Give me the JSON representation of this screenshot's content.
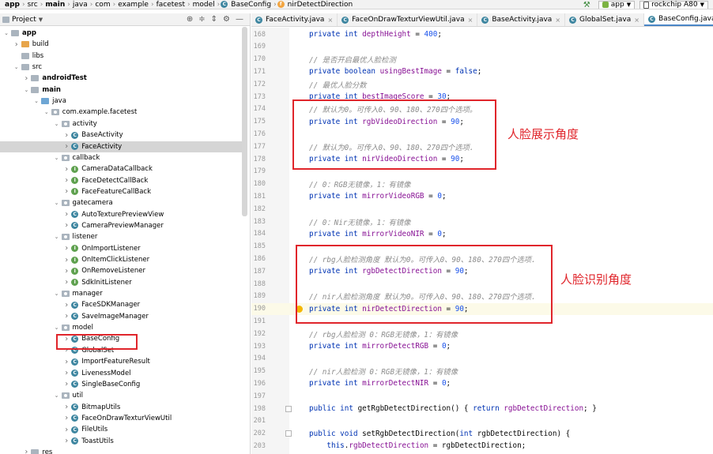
{
  "breadcrumb": {
    "items": [
      "app",
      "src",
      "main",
      "java",
      "com",
      "example",
      "facetest",
      "model",
      "BaseConfig",
      "nirDetectDirection"
    ],
    "bold_items": [
      0,
      2
    ]
  },
  "toolbar": {
    "run_config": "app",
    "device": "rockchip A80"
  },
  "project_panel": {
    "title": "Project",
    "tree": [
      {
        "label": "app",
        "depth": 0,
        "arrow": "v",
        "icon": "folder-gray",
        "bold": true
      },
      {
        "label": "build",
        "depth": 1,
        "arrow": ">",
        "icon": "folder-orange"
      },
      {
        "label": "libs",
        "depth": 1,
        "arrow": "",
        "icon": "folder-gray"
      },
      {
        "label": "src",
        "depth": 1,
        "arrow": "v",
        "icon": "folder-gray"
      },
      {
        "label": "androidTest",
        "depth": 2,
        "arrow": ">",
        "icon": "folder-gray",
        "bold": true
      },
      {
        "label": "main",
        "depth": 2,
        "arrow": "v",
        "icon": "folder-gray",
        "bold": true
      },
      {
        "label": "java",
        "depth": 3,
        "arrow": "v",
        "icon": "folder-blue"
      },
      {
        "label": "com.example.facetest",
        "depth": 4,
        "arrow": "v",
        "icon": "package"
      },
      {
        "label": "activity",
        "depth": 5,
        "arrow": "v",
        "icon": "package"
      },
      {
        "label": "BaseActivity",
        "depth": 6,
        "arrow": ">",
        "icon": "class"
      },
      {
        "label": "FaceActivity",
        "depth": 6,
        "arrow": ">",
        "icon": "class",
        "selected": true
      },
      {
        "label": "callback",
        "depth": 5,
        "arrow": "v",
        "icon": "package"
      },
      {
        "label": "CameraDataCallback",
        "depth": 6,
        "arrow": ">",
        "icon": "interface"
      },
      {
        "label": "FaceDetectCallBack",
        "depth": 6,
        "arrow": ">",
        "icon": "interface"
      },
      {
        "label": "FaceFeatureCallBack",
        "depth": 6,
        "arrow": ">",
        "icon": "interface"
      },
      {
        "label": "gatecamera",
        "depth": 5,
        "arrow": "v",
        "icon": "package"
      },
      {
        "label": "AutoTexturePreviewView",
        "depth": 6,
        "arrow": ">",
        "icon": "class"
      },
      {
        "label": "CameraPreviewManager",
        "depth": 6,
        "arrow": ">",
        "icon": "class"
      },
      {
        "label": "listener",
        "depth": 5,
        "arrow": "v",
        "icon": "package"
      },
      {
        "label": "OnImportListener",
        "depth": 6,
        "arrow": ">",
        "icon": "interface"
      },
      {
        "label": "OnItemClickListener",
        "depth": 6,
        "arrow": ">",
        "icon": "interface"
      },
      {
        "label": "OnRemoveListener",
        "depth": 6,
        "arrow": ">",
        "icon": "interface"
      },
      {
        "label": "SdkInitListener",
        "depth": 6,
        "arrow": ">",
        "icon": "interface"
      },
      {
        "label": "manager",
        "depth": 5,
        "arrow": "v",
        "icon": "package"
      },
      {
        "label": "FaceSDKManager",
        "depth": 6,
        "arrow": ">",
        "icon": "class"
      },
      {
        "label": "SaveImageManager",
        "depth": 6,
        "arrow": ">",
        "icon": "class"
      },
      {
        "label": "model",
        "depth": 5,
        "arrow": "v",
        "icon": "package"
      },
      {
        "label": "BaseConfig",
        "depth": 6,
        "arrow": ">",
        "icon": "class"
      },
      {
        "label": "GlobalSet",
        "depth": 6,
        "arrow": ">",
        "icon": "class"
      },
      {
        "label": "ImportFeatureResult",
        "depth": 6,
        "arrow": ">",
        "icon": "class"
      },
      {
        "label": "LivenessModel",
        "depth": 6,
        "arrow": ">",
        "icon": "class"
      },
      {
        "label": "SingleBaseConfig",
        "depth": 6,
        "arrow": ">",
        "icon": "class"
      },
      {
        "label": "util",
        "depth": 5,
        "arrow": "v",
        "icon": "package"
      },
      {
        "label": "BitmapUtils",
        "depth": 6,
        "arrow": ">",
        "icon": "class"
      },
      {
        "label": "FaceOnDrawTexturViewUtil",
        "depth": 6,
        "arrow": ">",
        "icon": "class"
      },
      {
        "label": "FileUtils",
        "depth": 6,
        "arrow": ">",
        "icon": "class"
      },
      {
        "label": "ToastUtils",
        "depth": 6,
        "arrow": ">",
        "icon": "class"
      },
      {
        "label": "res",
        "depth": 2,
        "arrow": ">",
        "icon": "folder-gray"
      }
    ]
  },
  "editor_tabs": [
    {
      "label": "FaceActivity.java",
      "active": false
    },
    {
      "label": "FaceOnDrawTexturViewUtil.java",
      "active": false
    },
    {
      "label": "BaseActivity.java",
      "active": false
    },
    {
      "label": "GlobalSet.java",
      "active": false
    },
    {
      "label": "BaseConfig.java",
      "active": true
    }
  ],
  "code_lines": [
    {
      "n": "168",
      "html": "<span class='kw'>private int </span><span class='fd'>depthHeight</span> = <span class='num'>400</span>;"
    },
    {
      "n": "169",
      "html": ""
    },
    {
      "n": "170",
      "html": "<span class='cm'>// 是否开启最优人脸检测</span>"
    },
    {
      "n": "171",
      "html": "<span class='kw'>private boolean </span><span class='fd'>usingBestImage</span> = <span class='kw'>false</span>;"
    },
    {
      "n": "172",
      "html": "<span class='cm'>// 最优人脸分数</span>"
    },
    {
      "n": "173",
      "html": "<span class='kw'>private int </span><span class='fd'>bestImageScore</span> = <span class='num'>30</span>;"
    },
    {
      "n": "174",
      "html": "<span class='cm'>// 默认为0。可传入0、90、180、270四个选项。</span>"
    },
    {
      "n": "175",
      "html": "<span class='kw'>private int </span><span class='fd'>rgbVideoDirection</span> = <span class='num'>90</span>;"
    },
    {
      "n": "176",
      "html": ""
    },
    {
      "n": "177",
      "html": "<span class='cm'>// 默认为0。可传入0、90、180、270四个选项.</span>"
    },
    {
      "n": "178",
      "html": "<span class='kw'>private int </span><span class='fd'>nirVideoDirection</span> = <span class='num'>90</span>;"
    },
    {
      "n": "179",
      "html": ""
    },
    {
      "n": "180",
      "html": "<span class='cm'>// 0：RGB无镜像，1：有镜像</span>"
    },
    {
      "n": "181",
      "html": "<span class='kw'>private int </span><span class='fd'>mirrorVideoRGB</span> = <span class='num'>0</span>;"
    },
    {
      "n": "182",
      "html": ""
    },
    {
      "n": "183",
      "html": "<span class='cm'>// 0：Nir无镜像，1：有镜像</span>"
    },
    {
      "n": "184",
      "html": "<span class='kw'>private int </span><span class='fd'>mirrorVideoNIR</span> = <span class='num'>0</span>;"
    },
    {
      "n": "185",
      "html": ""
    },
    {
      "n": "186",
      "html": "<span class='cm'>// rbg人脸检测角度 默认为0。可传入0、90、180、270四个选项.</span>"
    },
    {
      "n": "187",
      "html": "<span class='kw'>private int </span><span class='fd'>rgbDetectDirection</span> = <span class='num'>90</span>;"
    },
    {
      "n": "188",
      "html": ""
    },
    {
      "n": "189",
      "html": "<span class='cm'>// nir人脸检测角度 默认为0。可传入0、90、180、270四个选项.</span>"
    },
    {
      "n": "190",
      "html": "<span class='kw'>private int </span><span class='fd'>nirDetectDirection</span> = <span class='num'>90</span>;"
    },
    {
      "n": "191",
      "html": ""
    },
    {
      "n": "192",
      "html": "<span class='cm'>// rbg人脸检测 0：RGB无镜像，1：有镜像</span>"
    },
    {
      "n": "193",
      "html": "<span class='kw'>private int </span><span class='fd'>mirrorDetectRGB</span> = <span class='num'>0</span>;"
    },
    {
      "n": "194",
      "html": ""
    },
    {
      "n": "195",
      "html": "<span class='cm'>// nir人脸检测 0：RGB无镜像，1：有镜像</span>"
    },
    {
      "n": "196",
      "html": "<span class='kw'>private int </span><span class='fd'>mirrorDetectNIR</span> = <span class='num'>0</span>;"
    },
    {
      "n": "197",
      "html": ""
    },
    {
      "n": "198",
      "html": "<span class='kw'>public int </span>getRgbDetectDirection() { <span class='kw'>return </span><span class='fd'>rgbDetectDirection</span>; }"
    },
    {
      "n": "201",
      "html": ""
    },
    {
      "n": "202",
      "html": "<span class='kw'>public void </span>setRgbDetectDirection(<span class='kw'>int </span>rgbDetectDirection) {"
    },
    {
      "n": "203",
      "html": "    <span class='kw'>this</span>.<span class='fd'>rgbDetectDirection</span> = rgbDetectDirection;"
    }
  ],
  "annotations": {
    "face_display_angle": "人脸展示角度",
    "face_detect_angle": "人脸识别角度"
  },
  "colors": {
    "annotation_red": "#e0252b",
    "selection_gray": "#d5d5d5",
    "keyword_blue": "#0033b3",
    "field_purple": "#871094"
  }
}
